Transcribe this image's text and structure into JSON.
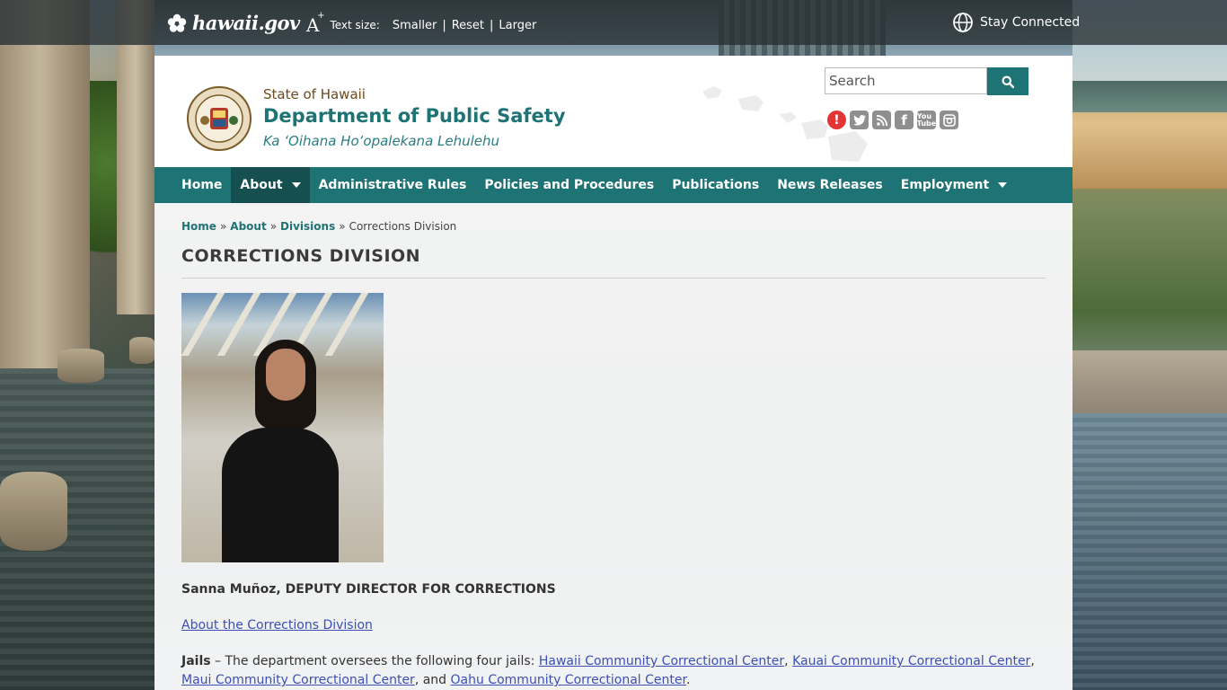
{
  "topbar": {
    "portal_logo": "hawaii.gov",
    "text_size_label": "Text size:",
    "text_size_options": [
      "Smaller",
      "Reset",
      "Larger"
    ],
    "stay_connected": "Stay Connected"
  },
  "header": {
    "state": "State of Hawaii",
    "department": "Department of Public Safety",
    "motto": "Ka ʻOihana Hoʻopalekana Lehulehu",
    "search_placeholder": "Search",
    "social_icons": [
      "alert-icon",
      "twitter-icon",
      "rss-icon",
      "facebook-icon",
      "youtube-icon",
      "instagram-icon"
    ]
  },
  "nav": {
    "items": [
      {
        "label": "Home",
        "active": false,
        "dropdown": false
      },
      {
        "label": "About",
        "active": true,
        "dropdown": true
      },
      {
        "label": "Administrative Rules",
        "active": false,
        "dropdown": false
      },
      {
        "label": "Policies and Procedures",
        "active": false,
        "dropdown": false
      },
      {
        "label": "Publications",
        "active": false,
        "dropdown": false
      },
      {
        "label": "News Releases",
        "active": false,
        "dropdown": false
      },
      {
        "label": "Employment",
        "active": false,
        "dropdown": true
      }
    ]
  },
  "breadcrumb": {
    "items": [
      "Home",
      "About",
      "Divisions"
    ],
    "current": "Corrections Division",
    "separator": "»"
  },
  "content": {
    "title": "CORRECTIONS DIVISION",
    "caption": "Sanna Muñoz, DEPUTY DIRECTOR FOR CORRECTIONS",
    "about_link": "About the Corrections Division",
    "jails_label": "Jails",
    "jails_intro": " – The department oversees the following four jails: ",
    "jail_links": [
      "Hawaii Community Correctional Center",
      "Kauai Community Correctional Center",
      "Maui Community Correctional Center",
      "Oahu Community Correctional Center"
    ],
    "jails_sep1": ", ",
    "jails_sep2": ", ",
    "jails_sep3": ", and ",
    "jails_end": "."
  },
  "colors": {
    "brand_teal": "#1e7374",
    "nav_active": "#154f50",
    "link": "#3b4fb5",
    "state_brown": "#6b4a1e"
  }
}
